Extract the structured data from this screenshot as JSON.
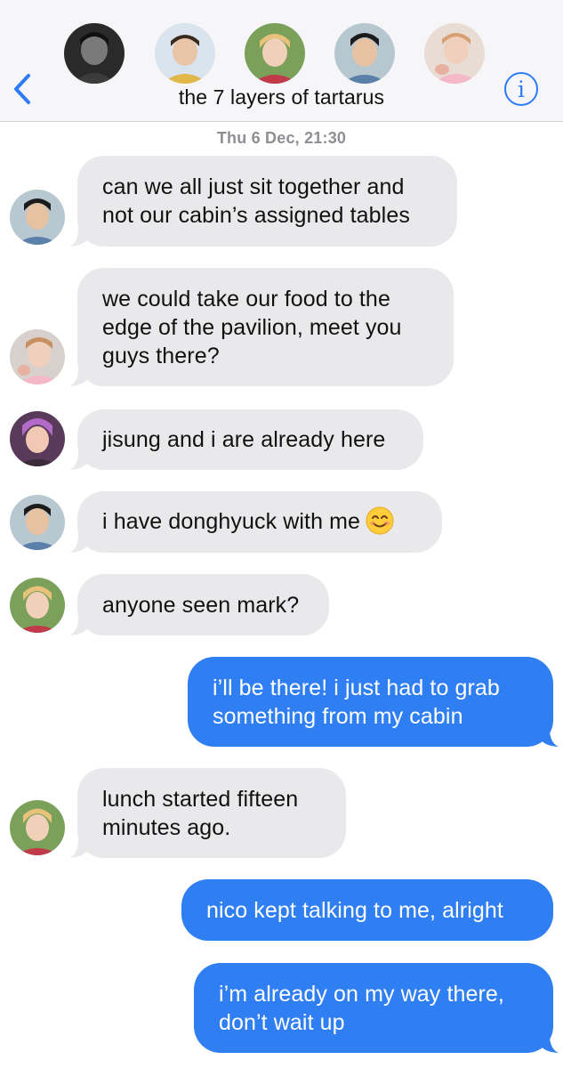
{
  "header": {
    "title": "the 7 layers of tartarus",
    "back_icon": "chevron-left-icon",
    "info_label": "i",
    "accent_color": "#2d7cf6"
  },
  "timestamp": {
    "day": "Thu 6 Dec,",
    "time": "21:30"
  },
  "messages": [
    {
      "direction": "incoming",
      "lines": [
        "can we all just sit together and",
        "not our cabin’s assigned tables"
      ]
    },
    {
      "direction": "incoming",
      "lines": [
        "we could take our food to the",
        "edge of the pavilion, meet you",
        "guys there?"
      ]
    },
    {
      "direction": "incoming",
      "lines": [
        "jisung and i are already here"
      ]
    },
    {
      "direction": "incoming",
      "lines": [
        "i have donghyuck with me"
      ],
      "emoji": "smiling-face-emoji"
    },
    {
      "direction": "incoming",
      "lines": [
        "anyone seen mark?"
      ]
    },
    {
      "direction": "outgoing",
      "lines": [
        "i’ll be there! i just had to grab",
        "something from my cabin"
      ]
    },
    {
      "direction": "incoming",
      "lines": [
        "lunch started fifteen",
        "minutes ago."
      ]
    },
    {
      "direction": "outgoing",
      "lines": [
        "nico kept talking to me, alright"
      ]
    },
    {
      "direction": "outgoing",
      "lines": [
        "i’m already on my way there,",
        "don’t wait up"
      ]
    }
  ],
  "colors": {
    "incoming_bubble": "#e9e9eb",
    "outgoing_bubble": "#2f7ff3",
    "header_bg": "#f6f6f8",
    "timestamp_text": "#8e8e93"
  }
}
